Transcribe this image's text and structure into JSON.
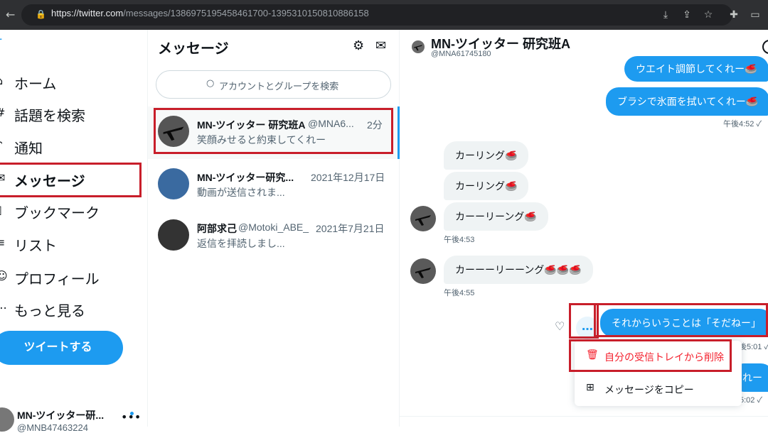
{
  "browser": {
    "url_host": "https://twitter.com",
    "url_path": "/messages/1386975195458461700-1395310150810886158"
  },
  "nav": {
    "items": [
      {
        "label": "ホーム",
        "icon": "home-icon"
      },
      {
        "label": "話題を検索",
        "icon": "hashtag-icon"
      },
      {
        "label": "通知",
        "icon": "bell-icon"
      },
      {
        "label": "メッセージ",
        "icon": "envelope-icon"
      },
      {
        "label": "ブックマーク",
        "icon": "bookmark-icon"
      },
      {
        "label": "リスト",
        "icon": "list-icon"
      },
      {
        "label": "プロフィール",
        "icon": "person-icon"
      },
      {
        "label": "もっと見る",
        "icon": "more-circle-icon"
      }
    ],
    "tweet_button": "ツイートする",
    "profile": {
      "name": "MN-ツイッター研...",
      "handle": "@MNB47463224"
    }
  },
  "messages": {
    "title": "メッセージ",
    "search_placeholder": "アカウントとグループを検索",
    "conversations": [
      {
        "name": "MN-ツイッター 研究班A",
        "handle": "@MNA6...",
        "time": "2分",
        "preview": "笑顔みせると約束してくれー"
      },
      {
        "name": "MN-ツイッター研究...",
        "handle": "",
        "time": "2021年12月17日",
        "preview": "動画が送信されま..."
      },
      {
        "name": "阿部求己",
        "handle": "@Motoki_ABE_",
        "time": "2021年7月21日",
        "preview": "返信を拝読しまし..."
      }
    ]
  },
  "chat": {
    "name": "MN-ツイッター 研究班A",
    "handle": "@MNA61745180",
    "messages": [
      {
        "text": "ウエイト調節してくれー🥌",
        "dir": "out"
      },
      {
        "text": "ブラシで氷面を拭いてくれー🥌",
        "dir": "out"
      },
      {
        "text": "午後4:52 ✓",
        "dir": "ts"
      },
      {
        "text": "カーリング🥌",
        "dir": "in"
      },
      {
        "text": "カーリング🥌",
        "dir": "in"
      },
      {
        "text": "カーーリーング🥌",
        "dir": "in"
      },
      {
        "text": "午後4:53",
        "dir": "ts"
      },
      {
        "text": "カーーーリーーング🥌🥌🥌",
        "dir": "in"
      },
      {
        "text": "午後4:55",
        "dir": "ts"
      },
      {
        "text": "それからいうことは「そだねー」",
        "dir": "out"
      },
      {
        "text": "後5:01 ✓",
        "dir": "ts"
      },
      {
        "text": "れー",
        "dir": "out"
      },
      {
        "text": "後5:02 ✓",
        "dir": "ts"
      }
    ],
    "more_glyph": "…",
    "menu": {
      "delete": "自分の受信トレイから削除",
      "copy": "メッセージをコピー"
    }
  },
  "colors": {
    "accent": "#1d9bf0",
    "annotation": "#c81e2a",
    "danger": "#f4212e"
  }
}
